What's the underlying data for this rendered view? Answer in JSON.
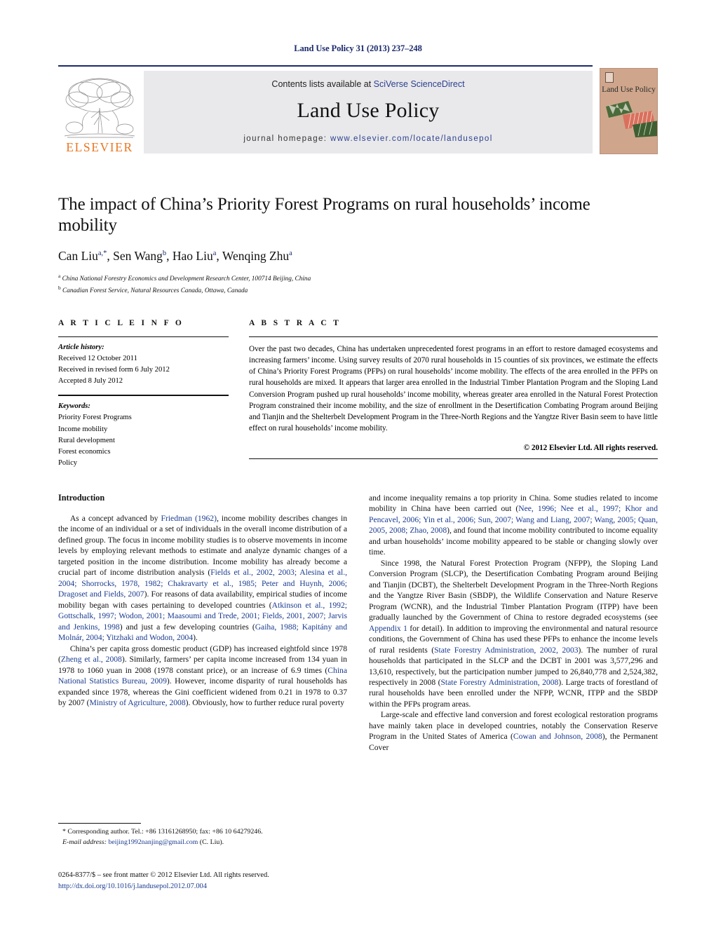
{
  "running_head": "Land Use Policy 31 (2013) 237–248",
  "masthead": {
    "contents_prefix": "Contents lists available at ",
    "contents_link": "SciVerse ScienceDirect",
    "journal_name": "Land Use Policy",
    "homepage_prefix": "journal homepage: ",
    "homepage_url": "www.elsevier.com/locate/landusepol",
    "publisher_logo_text": "ELSEVIER",
    "cover_title": "Land Use Policy",
    "link_color": "#2a3f8f",
    "logo_color": "#E87722",
    "rule_color": "#1a2a6c"
  },
  "article": {
    "title": "The impact of China’s Priority Forest Programs on rural households’ income mobility",
    "authors_html": "Can Liu<sup>a,*</sup>, Sen Wang<sup>b</sup>, Hao Liu<sup>a</sup>, Wenqing Zhu<sup>a</sup>",
    "affiliations": [
      {
        "marker": "a",
        "text": "China National Forestry Economics and Development Research Center, 100714 Beijing, China"
      },
      {
        "marker": "b",
        "text": "Canadian Forest Service, Natural Resources Canada, Ottawa, Canada"
      }
    ]
  },
  "article_info": {
    "heading": "A R T I C L E   I N F O",
    "history_label": "Article history:",
    "history": [
      "Received 12 October 2011",
      "Received in revised form 6 July 2012",
      "Accepted 8 July 2012"
    ],
    "keywords_label": "Keywords:",
    "keywords": [
      "Priority Forest Programs",
      "Income mobility",
      "Rural development",
      "Forest economics",
      "Policy"
    ]
  },
  "abstract": {
    "heading": "A B S T R A C T",
    "text": "Over the past two decades, China has undertaken unprecedented forest programs in an effort to restore damaged ecosystems and increasing farmers’ income. Using survey results of 2070 rural households in 15 counties of six provinces, we estimate the effects of China’s Priority Forest Programs (PFPs) on rural households’ income mobility. The effects of the area enrolled in the PFPs on rural households are mixed. It appears that larger area enrolled in the Industrial Timber Plantation Program and the Sloping Land Conversion Program pushed up rural households’ income mobility, whereas greater area enrolled in the Natural Forest Protection Program constrained their income mobility, and the size of enrollment in the Desertification Combating Program around Beijing and Tianjin and the Shelterbelt Development Program in the Three-North Regions and the Yangtze River Basin seem to have little effect on rural households’ income mobility.",
    "copyright": "© 2012 Elsevier Ltd. All rights reserved."
  },
  "body": {
    "section_heading": "Introduction",
    "left_column_html": "<p class=\"first\">As a concept advanced by <span class=\"ref\">Friedman (1962)</span>, income mobility describes changes in the income of an individual or a set of individuals in the overall income distribution of a defined group. The focus in income mobility studies is to observe movements in income levels by employing relevant methods to estimate and analyze dynamic changes of a targeted position in the income distribution. Income mobility has already become a crucial part of income distribution analysis (<span class=\"ref\">Fields et al., 2002, 2003; Alesina et al., 2004; Shorrocks, 1978, 1982; Chakravarty et al., 1985; Peter and Huynh, 2006; Dragoset and Fields, 2007</span>). For reasons of data availability, empirical studies of income mobility began with cases pertaining to developed countries (<span class=\"ref\">Atkinson et al., 1992; Gottschalk, 1997; Wodon, 2001; Maasoumi and Trede, 2001; Fields, 2001, 2007; Jarvis and Jenkins, 1998</span>) and just a few developing countries (<span class=\"ref\">Gaiha, 1988; Kapitány and Molnár, 2004; Yitzhaki and Wodon, 2004</span>).</p><p>China’s per capita gross domestic product (GDP) has increased eightfold since 1978 (<span class=\"ref\">Zheng et al., 2008</span>). Similarly, farmers’ per capita income increased from 134 yuan in 1978 to 1060 yuan in 2008 (1978 constant price), or an increase of 6.9 times (<span class=\"ref\">China National Statistics Bureau, 2009</span>). However, income disparity of rural households has expanded since 1978, whereas the Gini coefficient widened from 0.21 in 1978 to 0.37 by 2007 (<span class=\"ref\">Ministry of Agriculture, 2008</span>). Obviously, how to further reduce rural poverty</p>",
    "right_column_html": "<p style=\"text-indent:0\">and income inequality remains a top priority in China. Some studies related to income mobility in China have been carried out (<span class=\"ref\">Nee, 1996; Nee et al., 1997; Khor and Pencavel, 2006; Yin et al., 2006; Sun, 2007; Wang and Liang, 2007; Wang, 2005; Quan, 2005, 2008; Zhao, 2008</span>), and found that income mobility contributed to income equality and urban households’ income mobility appeared to be stable or changing slowly over time.</p><p>Since 1998, the Natural Forest Protection Program (NFPP), the Sloping Land Conversion Program (SLCP), the Desertification Combating Program around Beijing and Tianjin (DCBT), the Shelterbelt Development Program in the Three-North Regions and the Yangtze River Basin (SBDP), the Wildlife Conservation and Nature Reserve Program (WCNR), and the Industrial Timber Plantation Program (ITPP) have been gradually launched by the Government of China to restore degraded ecosystems (see <span class=\"ref\">Appendix 1</span> for detail). In addition to improving the environmental and natural resource conditions, the Government of China has used these PFPs to enhance the income levels of rural residents (<span class=\"ref\">State Forestry Administration, 2002, 2003</span>). The number of rural households that participated in the SLCP and the DCBT in 2001 was 3,577,296 and 13,610, respectively, but the participation number jumped to 26,840,778 and 2,524,382, respectively in 2008 (<span class=\"ref\">State Forestry Administration, 2008</span>). Large tracts of forestland of rural households have been enrolled under the NFPP, WCNR, ITPP and the SBDP within the PFPs program areas.</p><p>Large-scale and effective land conversion and forest ecological restoration programs have mainly taken place in developed countries, notably the Conservation Reserve Program in the United States of America (<span class=\"ref\">Cowan and Johnson, 2008</span>), the Permanent Cover</p>"
  },
  "footnote": {
    "corresponding": "* Corresponding author. Tel.: +86 13161268950; fax: +86 10 64279246.",
    "email_label": "E-mail address:",
    "email": "beijing1992nanjing@gmail.com",
    "email_suffix": "(C. Liu)."
  },
  "imprint": {
    "line1": "0264-8377/$ – see front matter © 2012 Elsevier Ltd. All rights reserved.",
    "doi": "http://dx.doi.org/10.1016/j.landusepol.2012.07.004"
  }
}
